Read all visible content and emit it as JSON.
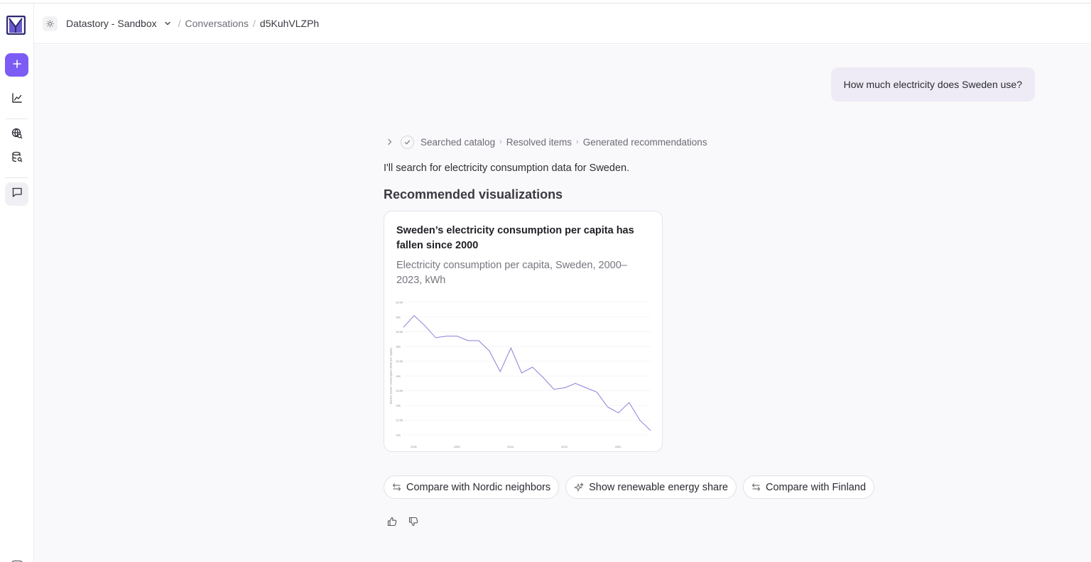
{
  "header": {
    "workspace": "Datastory - Sandbox",
    "breadcrumbs": [
      "Conversations",
      "d5KuhVLZPh"
    ]
  },
  "sidebar": {
    "icons": [
      "logo",
      "plus-icon",
      "chart-icon",
      "globe-search-icon",
      "database-search-icon",
      "chat-icon"
    ]
  },
  "conversation": {
    "user_message": "How much electricity does Sweden use?",
    "steps": [
      "Searched catalog",
      "Resolved items",
      "Generated recommendations"
    ],
    "assistant_intro": "I'll search for electricity consumption data for Sweden.",
    "section_title": "Recommended visualizations",
    "card": {
      "title": "Sweden’s electricity consumption per capita has fallen since 2000",
      "subtitle": "Electricity consumption per capita, Sweden, 2000–2023, kWh"
    },
    "suggestions": [
      "Compare with Nordic neighbors",
      "Show renewable energy share",
      "Compare with Finland"
    ]
  },
  "colors": {
    "accent": "#7c5cf5",
    "user_bubble": "#eeebf6",
    "series": "#8b7fd8"
  },
  "chart_data": {
    "type": "line",
    "ylabel": "Electric power consumption (kWh per capita)",
    "y_ticks": [
      "16.5K",
      "16K",
      "15.5K",
      "15K",
      "14.5K",
      "14K",
      "13.5K",
      "13K",
      "12.5K",
      "12K"
    ],
    "x_ticks": [
      "2001",
      "2005",
      "2010",
      "2015",
      "2020"
    ],
    "ylim": [
      12000,
      16500
    ],
    "x": [
      2000,
      2001,
      2002,
      2003,
      2004,
      2005,
      2006,
      2007,
      2008,
      2009,
      2010,
      2011,
      2012,
      2013,
      2014,
      2015,
      2016,
      2017,
      2018,
      2019,
      2020,
      2021,
      2022,
      2023
    ],
    "values": [
      15650,
      16050,
      15700,
      15300,
      15350,
      15350,
      15200,
      15200,
      14850,
      14150,
      14950,
      14100,
      14300,
      13950,
      13550,
      13600,
      13750,
      13600,
      13450,
      12950,
      12750,
      13100,
      12500,
      12150
    ],
    "grid": true
  }
}
